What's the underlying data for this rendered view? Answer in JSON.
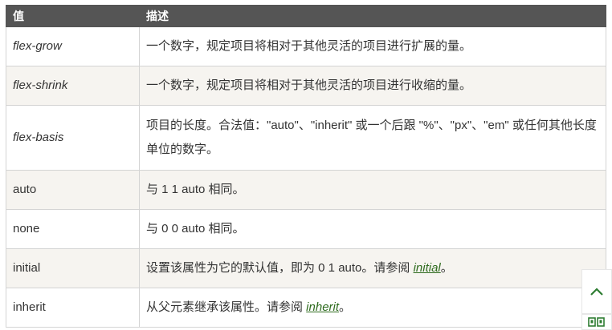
{
  "table": {
    "headers": [
      "值",
      "描述"
    ],
    "rows": [
      {
        "value": "flex-grow",
        "desc": "一个数字，规定项目将相对于其他灵活的项目进行扩展的量。"
      },
      {
        "value": "flex-shrink",
        "desc": "一个数字，规定项目将相对于其他灵活的项目进行收缩的量。"
      },
      {
        "value": "flex-basis",
        "desc": "项目的长度。合法值：\"auto\"、\"inherit\" 或一个后跟 \"%\"、\"px\"、\"em\" 或任何其他长度单位的数字。"
      },
      {
        "value": "auto",
        "desc": "与 1 1 auto 相同。"
      },
      {
        "value": "none",
        "desc": "与 0 0 auto 相同。"
      },
      {
        "value": "initial",
        "desc_before": "设置该属性为它的默认值，即为 0 1 auto。请参阅 ",
        "link": "initial",
        "desc_after": "。"
      },
      {
        "value": "inherit",
        "desc_before": "从父元素继承该属性。请参阅 ",
        "link": "inherit",
        "desc_after": "。"
      }
    ]
  },
  "floating": {
    "icons": [
      "chevron-up-icon",
      "qr-code-icon"
    ]
  }
}
